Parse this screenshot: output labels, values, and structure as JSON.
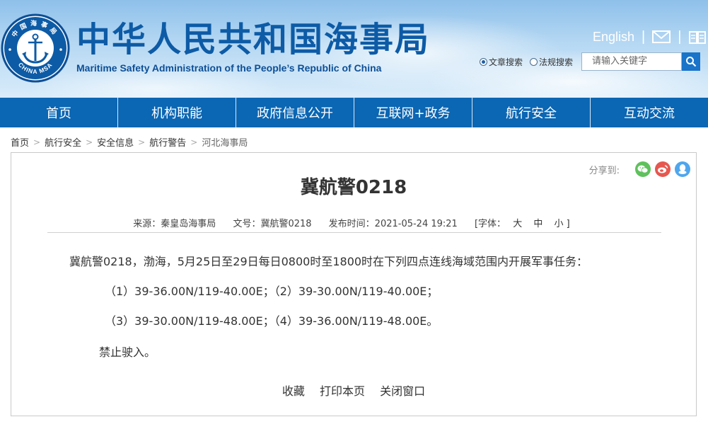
{
  "header": {
    "title": "中华人民共和国海事局",
    "subtitle": "Maritime Safety Administration of the People’s Republic of China",
    "logo_top_text": "中国海事局",
    "logo_bottom_text": "CHINA MSA",
    "english_link": "English",
    "separator": "|",
    "search": {
      "options": [
        "文章搜索",
        "法规搜索"
      ],
      "placeholder": "请输入关键字"
    }
  },
  "nav": {
    "items": [
      "首页",
      "机构职能",
      "政府信息公开",
      "互联网+政务",
      "航行安全",
      "互动交流"
    ]
  },
  "breadcrumb": {
    "items": [
      "首页",
      "航行安全",
      "安全信息",
      "航行警告",
      "河北海事局"
    ],
    "separator": ">"
  },
  "article": {
    "share_label": "分享到:",
    "title": "冀航警0218",
    "meta": {
      "source": "来源：秦皇岛海事局",
      "doc_no": "文号：冀航警0218",
      "publish_time": "发布时间：2021-05-24 19:21",
      "font_label": "[字体：",
      "font_large": "大",
      "font_medium": "中",
      "font_small": "小 ]"
    },
    "paragraphs": [
      "冀航警0218，渤海，5月25日至29日每日0800时至1800时在下列四点连线海域范围内开展军事任务：",
      "（1）39-36.00N/119-40.00E；（2）39-30.00N/119-40.00E；",
      "（3）39-30.00N/119-48.00E；（4）39-36.00N/119-48.00E。",
      "禁止驶入。"
    ],
    "actions": [
      "收藏",
      "打印本页",
      "关闭窗口"
    ]
  },
  "colors": {
    "brand_blue": "#0b66b3",
    "title_blue": "#0d5ba6",
    "wechat_green": "#5fc15c",
    "weibo_red": "#e6574f",
    "qq_blue": "#4fa6ee"
  }
}
